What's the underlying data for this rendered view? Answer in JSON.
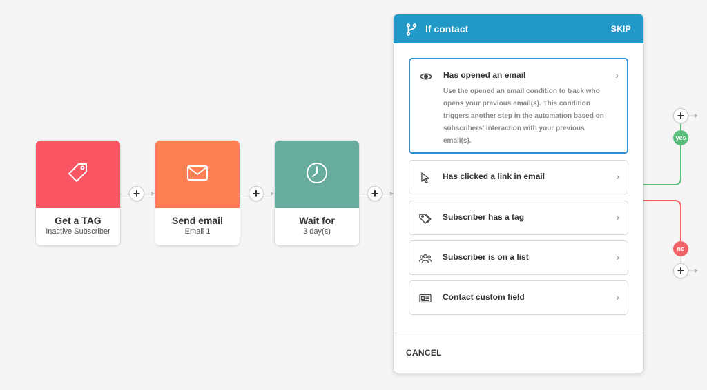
{
  "workflow": {
    "steps": [
      {
        "title": "Get a TAG",
        "subtitle": "Inactive Subscriber",
        "color": "#fa5562",
        "icon": "tag-icon"
      },
      {
        "title": "Send email",
        "subtitle": "Email 1",
        "color": "#fd8055",
        "icon": "envelope-icon"
      },
      {
        "title": "Wait for",
        "subtitle": "3 day(s)",
        "color": "#67ac9c",
        "icon": "clock-icon"
      }
    ],
    "add_step_symbol": "+"
  },
  "panel": {
    "title": "If contact",
    "skip_label": "SKIP",
    "header_color": "#2399c7",
    "options": [
      {
        "label": "Has opened an email",
        "icon": "eye-icon",
        "description": "Use the opened an email condition to track who opens your previous email(s). This condition triggers another step in the automation based on subscribers' interaction with your previous email(s).",
        "selected": true
      },
      {
        "label": "Has clicked a link in email",
        "icon": "cursor-icon"
      },
      {
        "label": "Subscriber has a tag",
        "icon": "tags-icon"
      },
      {
        "label": "Subscriber is on a list",
        "icon": "users-icon"
      },
      {
        "label": "Contact custom field",
        "icon": "id-card-icon"
      }
    ],
    "chevron": "›",
    "cancel_label": "CANCEL"
  },
  "branches": {
    "yes_label": "yes",
    "no_label": "no",
    "yes_color": "#5bbf7d",
    "no_color": "#f06468"
  }
}
